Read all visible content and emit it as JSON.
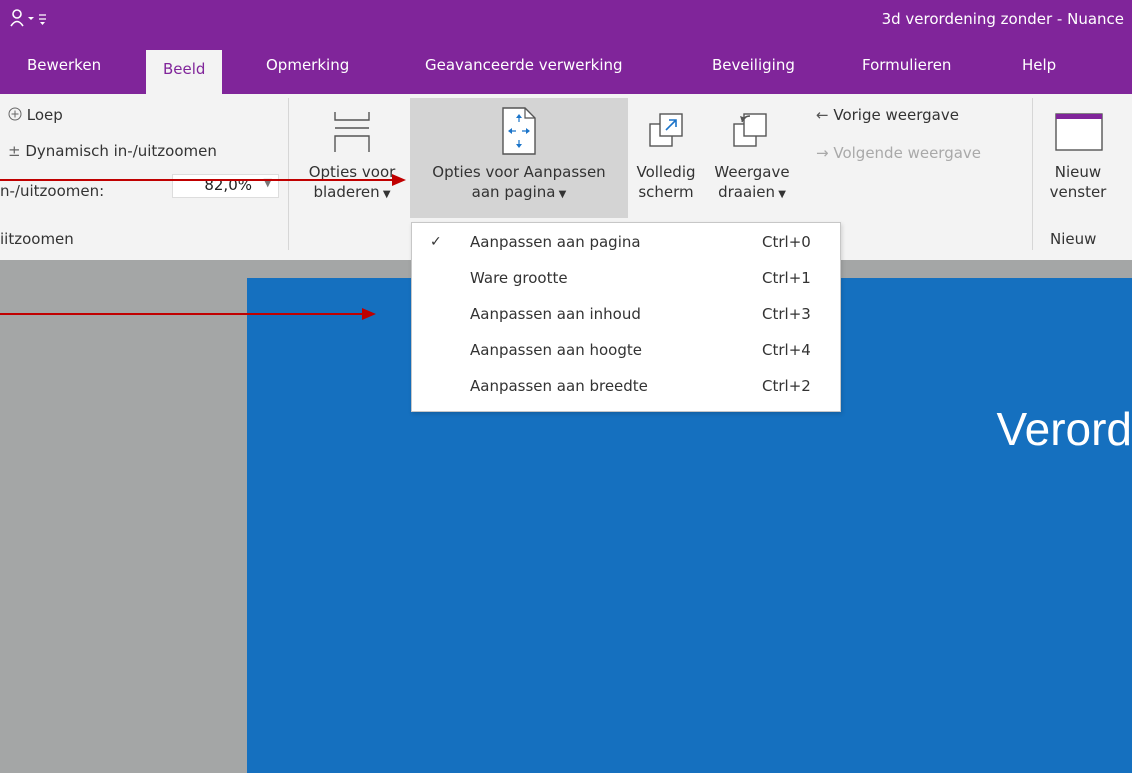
{
  "window": {
    "title": "3d verordening zonder - Nuance"
  },
  "tabs": [
    "Bewerken",
    "Beeld",
    "Opmerking",
    "Geavanceerde verwerking",
    "Beveiliging",
    "Formulieren",
    "Help"
  ],
  "ribbon": {
    "zoom_group": {
      "loep": "Loep",
      "dynamic_zoom": "Dynamisch in-/uitzoomen",
      "zoom_label": "n-/uitzoomen:",
      "zoom_value": "82,0%",
      "group_label": "iitzoomen"
    },
    "browse_button": {
      "line1": "Opties voor",
      "line2": "bladeren"
    },
    "fit_button": {
      "line1": "Opties voor Aanpassen",
      "line2": "aan pagina"
    },
    "fullscreen_button": {
      "line1": "Volledig",
      "line2": "scherm"
    },
    "rotate_button": {
      "line1": "Weergave",
      "line2": "draaien"
    },
    "prev_view": "Vorige weergave",
    "next_view": "Volgende weergave",
    "new_window_button": {
      "line1": "Nieuw",
      "line2": "venster"
    },
    "new_group_label": "Nieuw"
  },
  "fit_menu": {
    "items": [
      {
        "label": "Aanpassen aan pagina",
        "shortcut": "Ctrl+0",
        "checked": true
      },
      {
        "label": "Ware grootte",
        "shortcut": "Ctrl+1",
        "checked": false
      },
      {
        "label": "Aanpassen aan inhoud",
        "shortcut": "Ctrl+3",
        "checked": false
      },
      {
        "label": "Aanpassen aan hoogte",
        "shortcut": "Ctrl+4",
        "checked": false
      },
      {
        "label": "Aanpassen aan breedte",
        "shortcut": "Ctrl+2",
        "checked": false
      }
    ]
  },
  "document": {
    "heading_fragment": "Verord"
  },
  "colors": {
    "accent": "#80259a",
    "document_bg": "#1570bf",
    "annotation_arrow": "#c00000"
  }
}
